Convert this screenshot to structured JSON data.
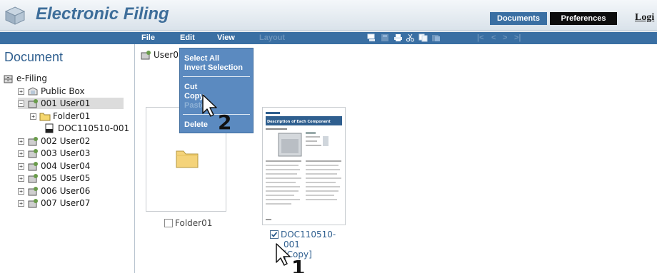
{
  "header": {
    "app_title": "Electronic Filing",
    "tabs": [
      {
        "label": "Documents",
        "active": true
      },
      {
        "label": "Preferences",
        "active": false
      }
    ],
    "login_label": "Logi",
    "logo_icon": "cube-icon"
  },
  "toolbar": {
    "menus": [
      {
        "label": "File",
        "enabled": true
      },
      {
        "label": "Edit",
        "enabled": true
      },
      {
        "label": "View",
        "enabled": true
      },
      {
        "label": "Layout",
        "enabled": false
      }
    ],
    "icons": [
      "print-preview-icon",
      "save-icon",
      "print-icon",
      "cut-icon",
      "copy-icon",
      "paste-icon"
    ],
    "nav_glyphs": [
      "|<",
      "<",
      ">",
      ">|"
    ]
  },
  "sidebar": {
    "heading": "Document",
    "root_label": "e-Filing",
    "items": [
      {
        "label": "Public Box",
        "expander": "+"
      },
      {
        "label": "001 User01",
        "expander": "−",
        "selected": true
      },
      {
        "label": "Folder01",
        "expander": "+"
      },
      {
        "label": "DOC110510-001"
      },
      {
        "label": "002 User02",
        "expander": "+"
      },
      {
        "label": "003 User03",
        "expander": "+"
      },
      {
        "label": "004 User04",
        "expander": "+"
      },
      {
        "label": "005 User05",
        "expander": "+"
      },
      {
        "label": "006 User06",
        "expander": "+"
      },
      {
        "label": "007 User07",
        "expander": "+"
      }
    ]
  },
  "main": {
    "breadcrumb": "User0",
    "folder_item": {
      "label": "Folder01",
      "checked": false
    },
    "doc_item": {
      "label_line1": "DOC110510-",
      "label_line2": "001",
      "label_line3": "[Copy]",
      "checked": true
    },
    "doc_thumbnail_title": "Description of Each Component"
  },
  "edit_menu": {
    "items": [
      "Select All",
      "Invert Selection",
      "Cut",
      "Copy",
      "Paste",
      "Delete"
    ],
    "disabled": [
      "Paste"
    ]
  },
  "callouts": {
    "step1": "1",
    "step2": "2"
  },
  "colors": {
    "header_bar": "#3a6fa3",
    "title": "#3e6e9a",
    "menu_bg": "#5b8ac0",
    "tab_active": "#3a6fa3",
    "tab_dark": "#0d0d0d"
  }
}
